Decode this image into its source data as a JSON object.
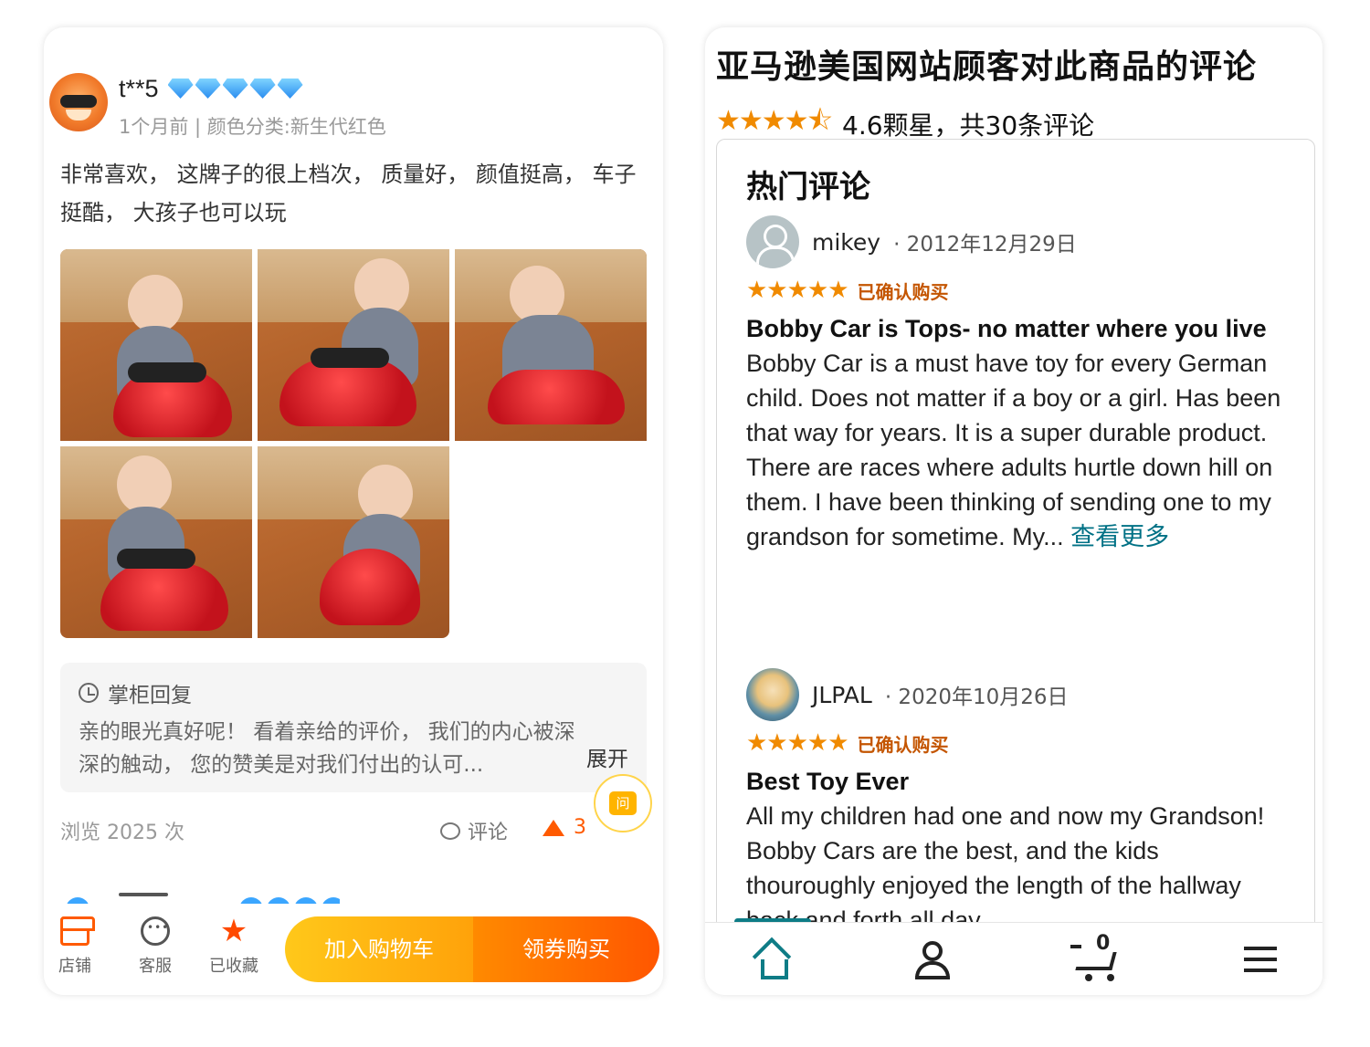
{
  "left": {
    "user": {
      "name": "t**5",
      "meta": "1个月前 | 颜色分类:新生代红色"
    },
    "review_text": "非常喜欢， 这牌子的很上档次， 质量好， 颜值挺高， 车子挺酷， 大孩子也可以玩",
    "reply": {
      "title": "掌柜回复",
      "text": "亲的眼光真好呢！ 看着亲给的评价， 我们的内心被深深的触动， 您的赞美是对我们付出的认可...",
      "expand": "展开"
    },
    "ask_label": "问",
    "stats": {
      "views": "浏览 2025 次",
      "comment": "评论",
      "likes": "3"
    },
    "bottom_bar": {
      "store": "店铺",
      "service": "客服",
      "favorited": "已收藏",
      "add_to_cart": "加入购物车",
      "coupon_buy": "领券购买"
    },
    "colors": {
      "accent": "#ff5a00",
      "cart_button": "#ffb30f"
    }
  },
  "right": {
    "header": "亚马逊美国网站顾客对此商品的评论",
    "rating": {
      "stars": "★★★★⯪",
      "text": "4.6颗星，共30条评论"
    },
    "section_title": "热门评论",
    "reviews": [
      {
        "name": "mikey",
        "date": "· 2012年12月29日",
        "stars": "★★★★★",
        "verified": "已确认购买",
        "title": "Bobby Car is Tops- no matter where you live",
        "body": "Bobby Car is a must have toy for every German child. Does not matter if a boy or a girl. Has been that way for years. It is a super durable product. There are races where adults hurtle down hill on them. I have been thinking of sending one to my grandson for sometime. My...",
        "see_more": "查看更多"
      },
      {
        "name": "JLPAL",
        "date": "· 2020年10月26日",
        "stars": "★★★★★",
        "verified": "已确认购买",
        "title": "Best Toy Ever",
        "body": "All my children had one and now my Grandson! Bobby Cars are the best, and the kids thouroughly enjoyed the length of the hallway back and forth all day."
      }
    ],
    "nav": {
      "cart_count": "0"
    },
    "colors": {
      "star": "#f08a00",
      "link": "#007185",
      "verified": "#c45500"
    }
  }
}
